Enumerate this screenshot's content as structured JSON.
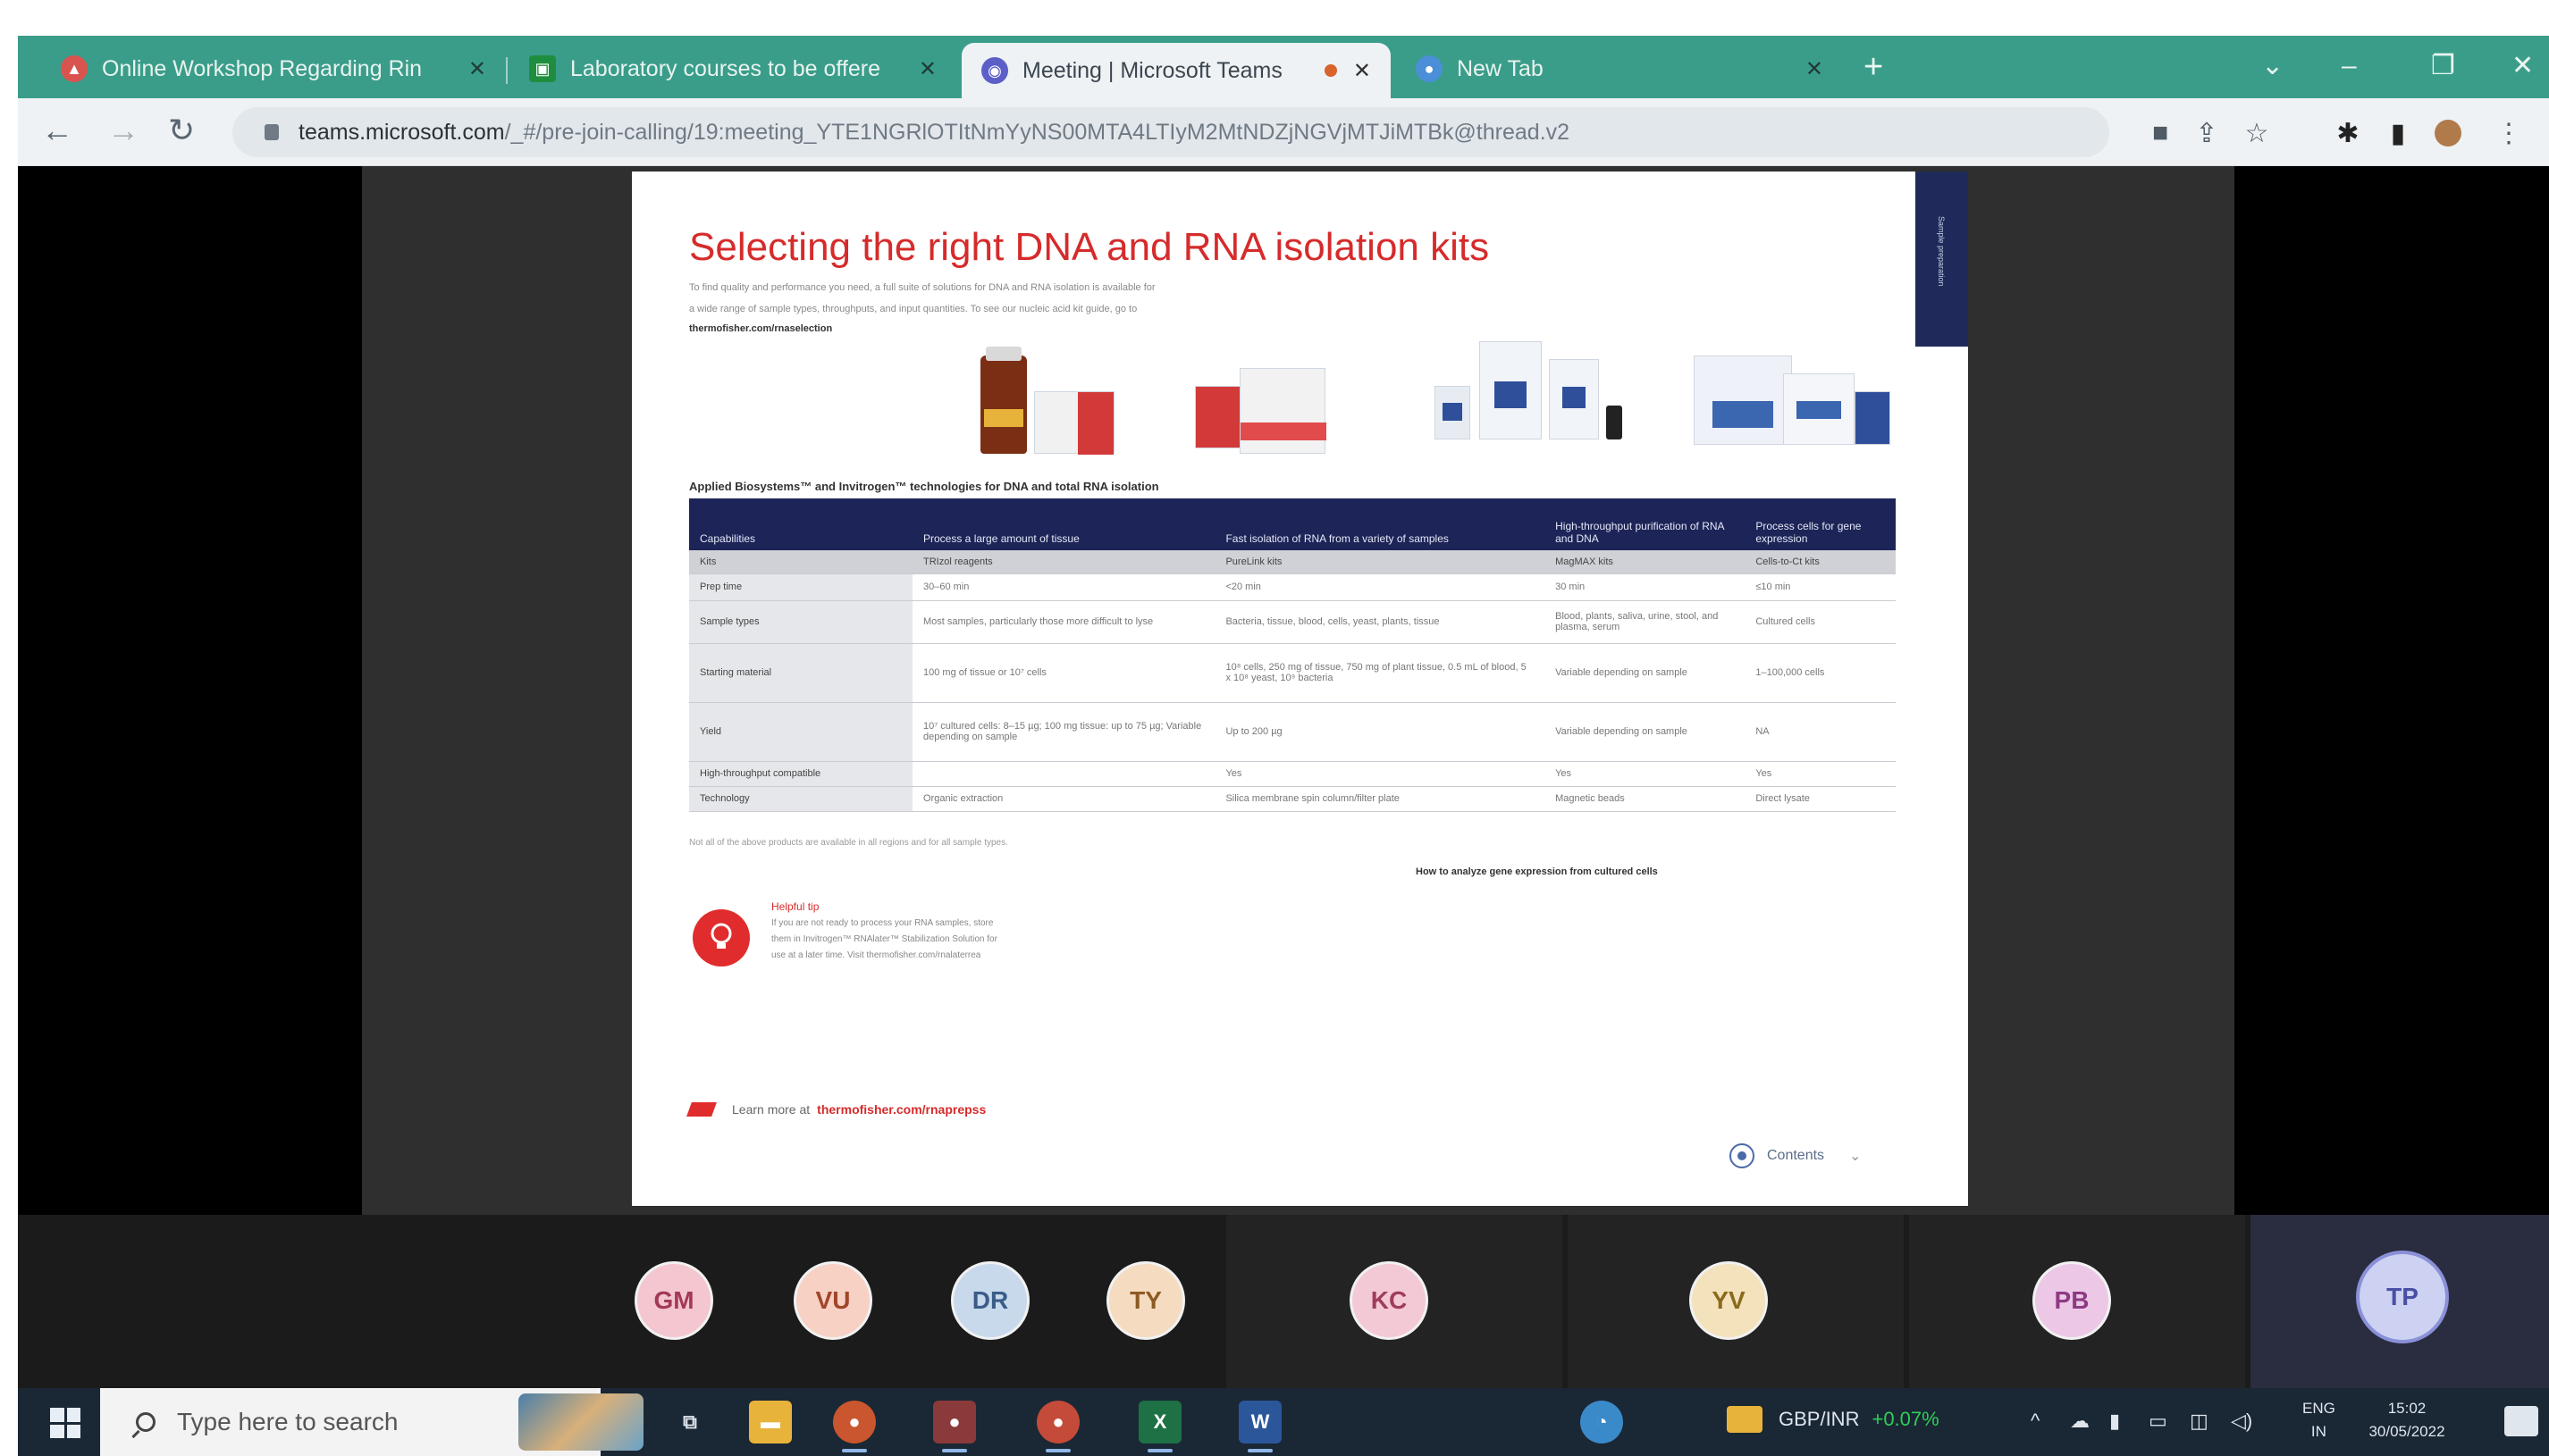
{
  "browser": {
    "tabs": [
      {
        "title": "Online Workshop Regarding Rin",
        "favicon": "graduation-icon",
        "color": "#d9534f"
      },
      {
        "title": "Laboratory courses to be offere",
        "favicon": "classroom-icon",
        "color": "#1e8e3e"
      },
      {
        "title": "Meeting | Microsoft Teams",
        "favicon": "teams-icon",
        "color": "#5b5fc7"
      },
      {
        "title": "New Tab",
        "favicon": "chrome-icon",
        "color": "#4a8fd8"
      }
    ],
    "new_tab_label": "+",
    "url_host": "teams.microsoft.com",
    "url_path": "/_#/pre-join-calling/19:meeting_YTE1NGRlOTItNmYyNS00MTA4LTIyM2MtNDZjNGVjMTJiMTBk@thread.v2"
  },
  "slide": {
    "title": "Selecting the right DNA and RNA isolation kits",
    "intro_lines": [
      "To find quality and performance you need, a full suite of solutions for DNA and RNA isolation is available for",
      "a wide range of sample types, throughputs, and input quantities. To see our nucleic acid kit guide, go to",
      "thermofisher.com/rnaselection"
    ],
    "side_tab_text": "Sample preparation",
    "table": {
      "caption": "Applied Biosystems™ and Invitrogen™ technologies for DNA and total RNA isolation",
      "headers": [
        "Capabilities",
        "Process a large amount of tissue",
        "Fast isolation of RNA from a variety of samples",
        "High-throughput purification of RNA and DNA",
        "Process cells for gene expression"
      ],
      "rows": [
        [
          "Kits",
          "TRIzol reagents",
          "PureLink kits",
          "MagMAX kits",
          "Cells-to-Ct kits"
        ],
        [
          "Prep time",
          "30–60 min",
          "<20 min",
          "30 min",
          "≤10 min"
        ],
        [
          "Sample types",
          "Most samples, particularly those more difficult to lyse",
          "Bacteria, tissue, blood, cells, yeast, plants, tissue",
          "Blood, plants, saliva, urine, stool, and plasma, serum",
          "Cultured cells"
        ],
        [
          "Starting material",
          "100 mg of tissue or 10⁷ cells",
          "10⁸ cells, 250 mg of tissue, 750 mg of plant tissue, 0.5 mL of blood, 5 x 10⁸ yeast, 10⁹ bacteria",
          "Variable depending on sample",
          "1–100,000 cells"
        ],
        [
          "Yield",
          "10⁷ cultured cells: 8–15 µg; 100 mg tissue: up to 75 µg; Variable depending on sample",
          "Up to 200 µg",
          "Variable depending on sample",
          "NA"
        ],
        [
          "High-throughput compatible",
          "",
          "Yes",
          "Yes",
          "Yes"
        ],
        [
          "Technology",
          "Organic extraction",
          "Silica membrane spin column/filter plate",
          "Magnetic beads",
          "Direct lysate"
        ]
      ],
      "footnote": "Not all of the above products are available in all regions and for all sample types."
    },
    "app_note_link": "How to analyze gene expression from cultured cells",
    "tip": {
      "title": "Helpful tip",
      "lines": [
        "If you are not ready to process your RNA samples, store",
        "them in Invitrogen™ RNAlater™ Stabilization Solution for",
        "use at a later time. Visit thermofisher.com/rnalaterrea"
      ]
    },
    "learn_more_prefix": "Learn more at",
    "learn_more_url": "thermofisher.com/rnaprepss",
    "contents_label": "Contents"
  },
  "participants": [
    {
      "initials": "GM",
      "bg": "#f4c6cf",
      "fg": "#a23a56"
    },
    {
      "initials": "VU",
      "bg": "#f7d1c4",
      "fg": "#a2452a"
    },
    {
      "initials": "DR",
      "bg": "#c9d9ec",
      "fg": "#3a5c88"
    },
    {
      "initials": "TY",
      "bg": "#f5dcc0",
      "fg": "#8e5a24"
    },
    {
      "initials": "KC",
      "bg": "#f4c9d6",
      "fg": "#a03c5c"
    },
    {
      "initials": "YV",
      "bg": "#f3e2bb",
      "fg": "#8a6a1c"
    },
    {
      "initials": "PB",
      "bg": "#ecc8e6",
      "fg": "#8e3a84"
    },
    {
      "initials": "TP",
      "bg": "#cdd2f2",
      "fg": "#4a4fa6"
    }
  ],
  "taskbar": {
    "search_placeholder": "Type here to search",
    "currency_label": "GBP/INR",
    "currency_change": "+0.07%",
    "lang_top": "ENG",
    "lang_bottom": "IN",
    "time": "15:02",
    "date": "30/05/2022"
  }
}
